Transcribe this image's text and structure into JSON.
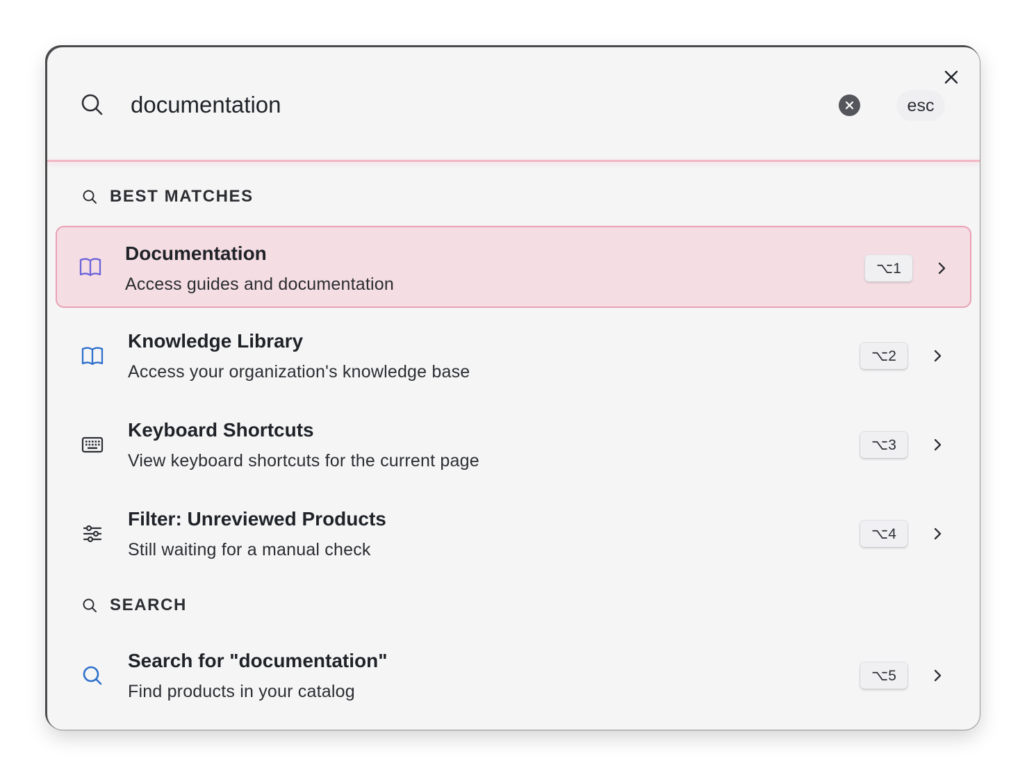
{
  "search": {
    "value": "documentation",
    "esc_label": "esc"
  },
  "sections": {
    "best_matches": "BEST MATCHES",
    "search": "SEARCH"
  },
  "items": [
    {
      "title": "Documentation",
      "subtitle": "Access guides and documentation",
      "shortcut": "⌥1",
      "icon": "book-open-icon",
      "icon_color": "#6c63d9",
      "active": true
    },
    {
      "title": "Knowledge Library",
      "subtitle": "Access your organization's knowledge base",
      "shortcut": "⌥2",
      "icon": "book-open-icon",
      "icon_color": "#2e6fcb",
      "active": false
    },
    {
      "title": "Keyboard Shortcuts",
      "subtitle": "View keyboard shortcuts for the current page",
      "shortcut": "⌥3",
      "icon": "keyboard-icon",
      "icon_color": "#2b2d31",
      "active": false
    },
    {
      "title": "Filter: Unreviewed Products",
      "subtitle": "Still waiting for a manual check",
      "shortcut": "⌥4",
      "icon": "sliders-icon",
      "icon_color": "#2b2d31",
      "active": false
    },
    {
      "title": "Search for \"documentation\"",
      "subtitle": "Find products in your catalog",
      "shortcut": "⌥5",
      "icon": "search-icon",
      "icon_color": "#2e6fcb",
      "active": false
    }
  ],
  "colors": {
    "accent_pink": "#eaa1b3",
    "active_bg": "#f4dde3",
    "dialog_bg": "#f5f5f6"
  }
}
